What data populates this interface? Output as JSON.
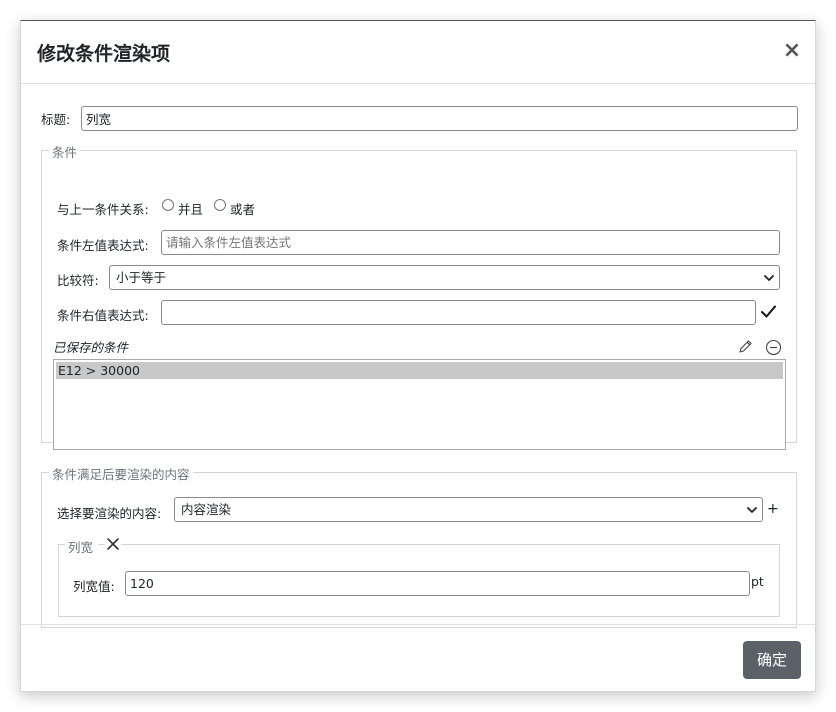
{
  "modal": {
    "title": "修改条件渲染项",
    "close_label": "×",
    "ok_label": "确定"
  },
  "title_field": {
    "label": "标题:",
    "value": "列宽"
  },
  "condition_section": {
    "legend": "条件",
    "relation_label": "与上一条件关系:",
    "relation_options": [
      "并且",
      "或者"
    ],
    "left_expr_label": "条件左值表达式:",
    "left_expr_placeholder": "请输入条件左值表达式",
    "left_expr_value": "",
    "operator_label": "比较符:",
    "operator_value": "小于等于",
    "right_expr_label": "条件右值表达式:",
    "right_expr_value": "",
    "saved_label": "已保存的条件",
    "saved_items": [
      "E12 > 30000"
    ]
  },
  "render_section": {
    "legend": "条件满足后要渲染的内容",
    "content_label": "选择要渲染的内容:",
    "content_value": "内容渲染",
    "add_label": "+",
    "item": {
      "legend": "列宽",
      "field_label": "列宽值:",
      "field_value": "120",
      "unit": "pt"
    }
  },
  "icons": {
    "close": "close-icon",
    "confirm": "check-icon",
    "edit": "pencil-icon",
    "remove": "minus-circle-icon",
    "delete_item": "x-icon",
    "dropdown": "chevron-down-icon"
  }
}
